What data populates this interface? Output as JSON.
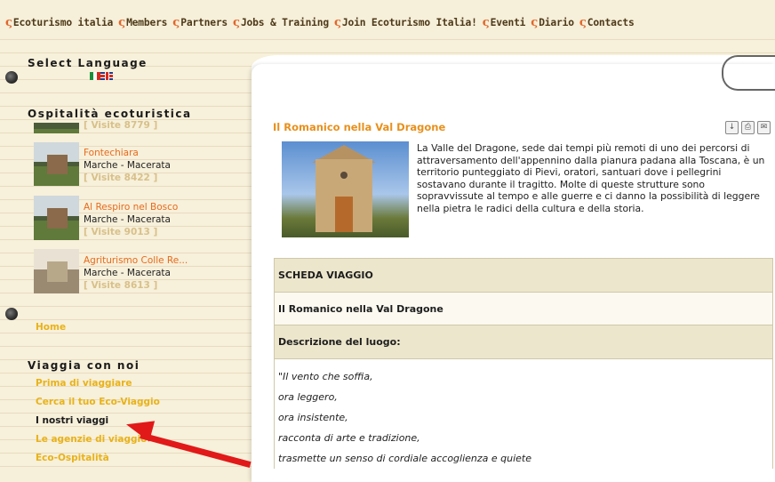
{
  "topnav": [
    {
      "label": "Ecoturismo italia"
    },
    {
      "label": "Members"
    },
    {
      "label": "Partners"
    },
    {
      "label": "Jobs & Training"
    },
    {
      "label": "Join Ecoturismo Italia!"
    },
    {
      "label": "Eventi"
    },
    {
      "label": "Diario"
    },
    {
      "label": "Contacts"
    }
  ],
  "sidebar": {
    "language_heading": "Select Language",
    "ospitalita_heading": "Ospitalità ecoturistica",
    "first_visits": "[ Visite 8779 ]",
    "hotels": [
      {
        "name": "Fontechiara",
        "location": "Marche - Macerata",
        "visits": "[ Visite 8422 ]"
      },
      {
        "name": "Al Respiro nel Bosco",
        "location": "Marche - Macerata",
        "visits": "[ Visite 9013 ]"
      },
      {
        "name": "Agriturismo Colle Re...",
        "location": "Marche - Macerata",
        "visits": "[ Visite 8613 ]"
      }
    ],
    "home_link": "Home",
    "viaggia_heading": "Viaggia con noi",
    "viaggia_links": [
      {
        "label": "Prima di viaggiare"
      },
      {
        "label": "Cerca il tuo Eco-Viaggio"
      },
      {
        "label": "I nostri viaggi"
      },
      {
        "label": "Le agenzie di viaggio"
      },
      {
        "label": "Eco-Ospitalità"
      }
    ]
  },
  "article": {
    "title": "Il Romanico nella Val Dragone",
    "intro": "La Valle del Dragone, sede dai tempi più remoti di uno dei percorsi di attraversamento dell'appennino dalla pianura padana alla Toscana, è un territorio punteggiato di Pievi, oratori, santuari dove i pellegrini sostavano durante il tragitto. Molte di queste strutture sono sopravvissute al tempo e alle guerre e ci danno la possibilità di leggere nella pietra le radici della cultura e della storia.",
    "sheet": {
      "heading": "SCHEDA VIAGGIO",
      "trip_name": "Il Romanico nella Val Dragone",
      "description_heading": "Descrizione del luogo:",
      "verses": [
        "\"Il vento che soffia,",
        "ora leggero,",
        "ora insistente,",
        "racconta di arte e tradizione,",
        "trasmette un senso di cordiale accoglienza e quiete"
      ]
    }
  },
  "colors": {
    "accent_orange": "#e8901c",
    "link_yellow": "#e8b21a",
    "arrow_red": "#e11919"
  },
  "icons": [
    "pdf-icon",
    "print-icon",
    "email-icon",
    "paperclip-icon"
  ]
}
